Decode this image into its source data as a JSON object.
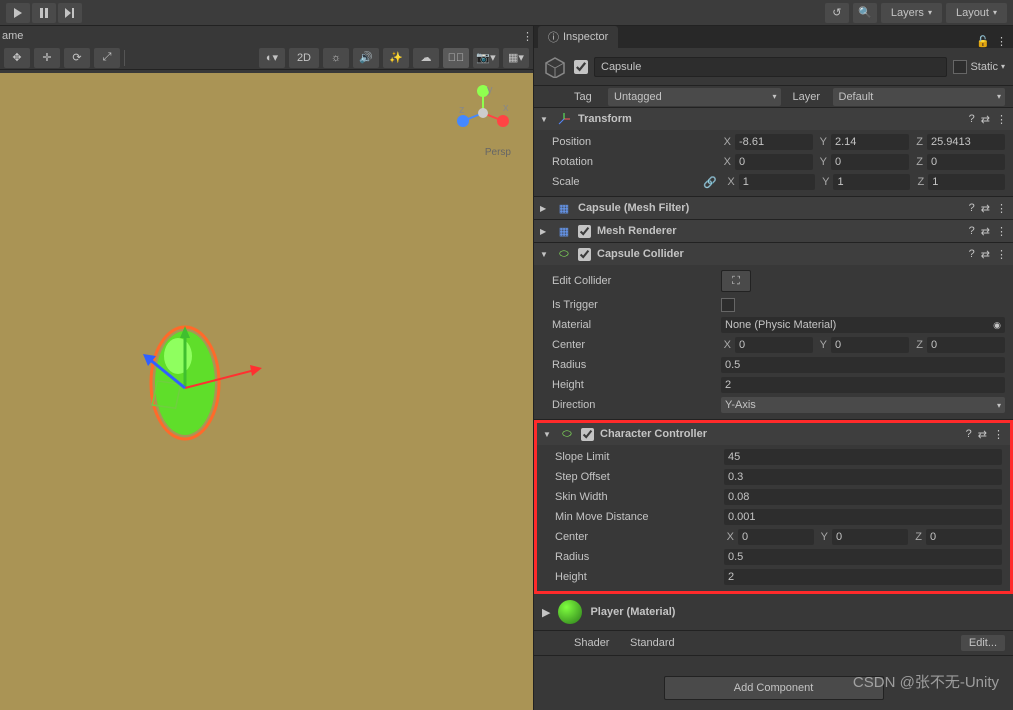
{
  "topbar": {
    "layers": "Layers",
    "layout": "Layout"
  },
  "viewport": {
    "label_partial": "ame",
    "projection": "Persp"
  },
  "scene_tools": {
    "mode_2d": "2D"
  },
  "inspector": {
    "tab": "Inspector",
    "object_name": "Capsule",
    "static_label": "Static",
    "tag_label": "Tag",
    "tag_value": "Untagged",
    "layer_label": "Layer",
    "layer_value": "Default"
  },
  "transform": {
    "title": "Transform",
    "position_label": "Position",
    "pos": {
      "x": "-8.61",
      "y": "2.14",
      "z": "25.9413"
    },
    "rotation_label": "Rotation",
    "rot": {
      "x": "0",
      "y": "0",
      "z": "0"
    },
    "scale_label": "Scale",
    "scl": {
      "x": "1",
      "y": "1",
      "z": "1"
    }
  },
  "mesh_filter": {
    "title": "Capsule (Mesh Filter)"
  },
  "mesh_renderer": {
    "title": "Mesh Renderer"
  },
  "capsule_collider": {
    "title": "Capsule Collider",
    "edit_collider": "Edit Collider",
    "is_trigger": "Is Trigger",
    "material_label": "Material",
    "material_value": "None (Physic Material)",
    "center_label": "Center",
    "center": {
      "x": "0",
      "y": "0",
      "z": "0"
    },
    "radius_label": "Radius",
    "radius": "0.5",
    "height_label": "Height",
    "height": "2",
    "direction_label": "Direction",
    "direction": "Y-Axis"
  },
  "character_controller": {
    "title": "Character Controller",
    "slope_limit_label": "Slope Limit",
    "slope_limit": "45",
    "step_offset_label": "Step Offset",
    "step_offset": "0.3",
    "skin_width_label": "Skin Width",
    "skin_width": "0.08",
    "min_move_label": "Min Move Distance",
    "min_move": "0.001",
    "center_label": "Center",
    "center": {
      "x": "0",
      "y": "0",
      "z": "0"
    },
    "radius_label": "Radius",
    "radius": "0.5",
    "height_label": "Height",
    "height": "2"
  },
  "material_section": {
    "name": "Player (Material)",
    "shader_label": "Shader",
    "shader_value": "Standard",
    "edit": "Edit..."
  },
  "add_component": "Add Component",
  "watermark": "CSDN @张不无-Unity"
}
